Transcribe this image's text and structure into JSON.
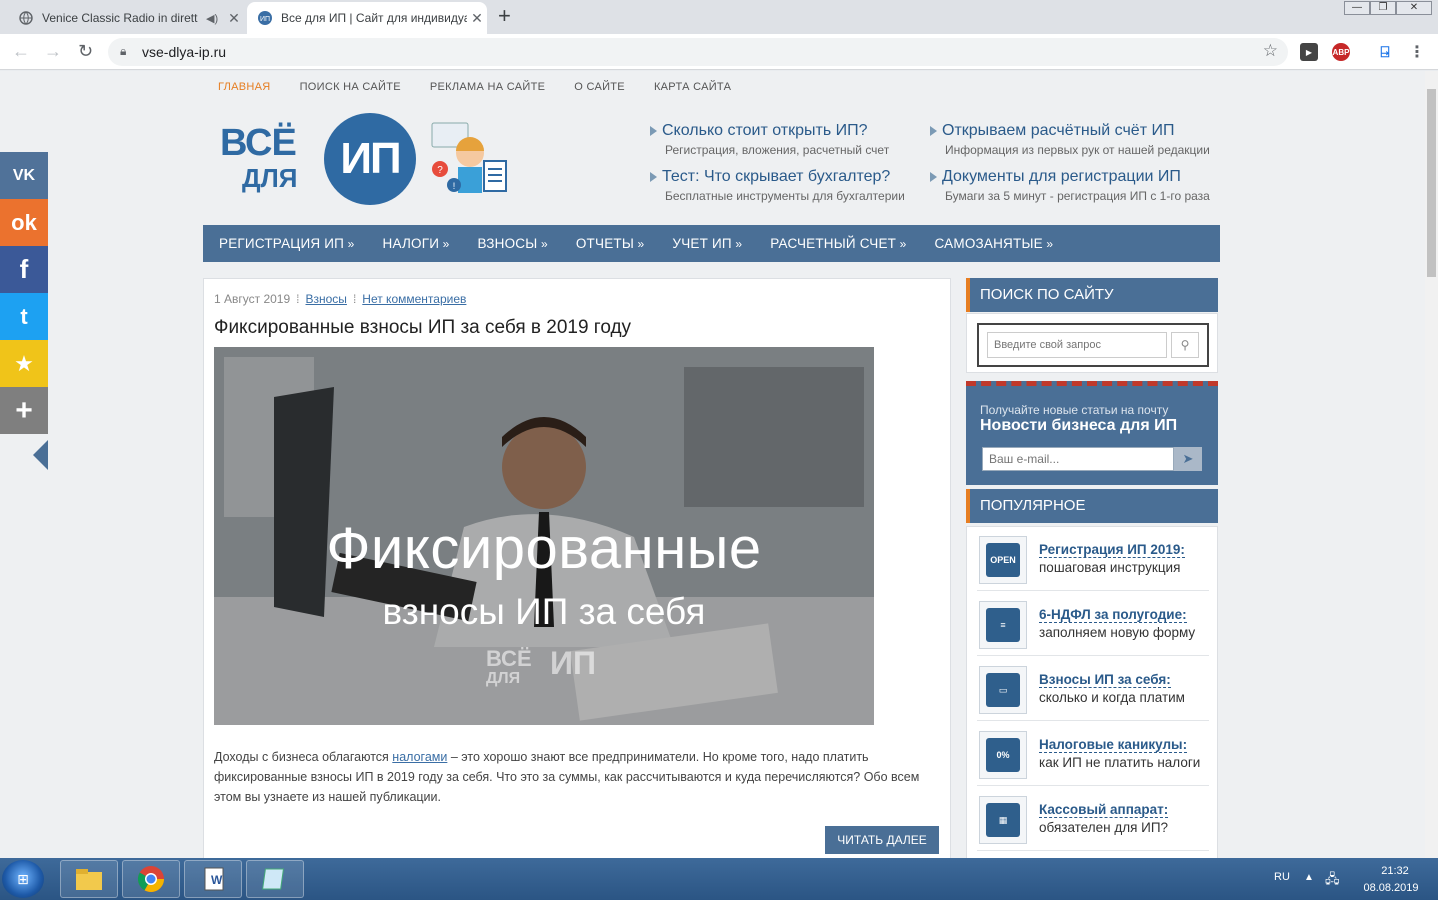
{
  "browser": {
    "tabs": [
      {
        "title": "Venice Classic Radio in dirett",
        "active": false
      },
      {
        "title": "Все для ИП | Сайт для индивидуальных",
        "active": true
      }
    ],
    "url": "vse-dlya-ip.ru",
    "extensions": [
      "video-downloader-icon",
      "adblock-icon",
      "translate-icon"
    ],
    "adblock_label": "ABP"
  },
  "site": {
    "top_menu": [
      "ГЛАВНАЯ",
      "ПОИСК НА САЙТЕ",
      "РЕКЛАМА НА САЙТЕ",
      "О САЙТЕ",
      "КАРТА САЙТА"
    ],
    "logo": {
      "line1": "ВСЁ",
      "line2": "ДЛЯ",
      "ip": "ИП"
    },
    "promos": [
      {
        "title": "Сколько стоит открыть ИП?",
        "subtitle": "Регистрация, вложения, расчетный счет"
      },
      {
        "title": "Открываем расчётный счёт ИП",
        "subtitle": "Информация из первых рук от нашей редакции"
      },
      {
        "title": "Тест: Что скрывает бухгалтер?",
        "subtitle": "Бесплатные инструменты для бухгалтерии"
      },
      {
        "title": "Документы для регистрации ИП",
        "subtitle": "Бумаги за 5 минут - регистрация ИП с 1-го раза"
      }
    ],
    "main_nav": [
      "РЕГИСТРАЦИЯ ИП",
      "НАЛОГИ",
      "ВЗНОСЫ",
      "ОТЧЕТЫ",
      "УЧЕТ ИП",
      "РАСЧЕТНЫЙ СЧЕТ",
      "САМОЗАНЯТЫЕ"
    ]
  },
  "article": {
    "date": "1 Август 2019",
    "separator": "⁞",
    "category": "Взносы",
    "comments": "Нет комментариев",
    "title": "Фиксированные взносы ИП за себя в 2019 году",
    "hero_line1": "Фиксированные",
    "hero_line2": "взносы ИП за себя",
    "hero_wm1": "ВСЁ",
    "hero_wm2": "ДЛЯ",
    "hero_wm3": "ИП",
    "excerpt_before": "Доходы с бизнеса облагаются ",
    "excerpt_link": "налогами",
    "excerpt_after": " – это хорошо знают все предприниматели. Но кроме того, надо платить фиксированные взносы ИП в 2019 году за себя. Что это за суммы, как рассчитываются и куда перечисляются? Обо всем этом вы узнаете из нашей публикации.",
    "read_more": "ЧИТАТЬ ДАЛЕЕ"
  },
  "sidebar": {
    "search_title": "ПОИСК ПО САЙТУ",
    "search_placeholder": "Введите свой запрос",
    "newsletter_text": "Получайте новые статьи на почту",
    "newsletter_title": "Новости бизнеса для ИП",
    "email_placeholder": "Ваш e-mail...",
    "popular_title": "ПОПУЛЯРНОЕ",
    "popular": [
      {
        "title": "Регистрация ИП 2019:",
        "sub": "пошаговая инструкция",
        "icon": "open-sign-icon",
        "icon_text": "OPEN"
      },
      {
        "title": "6-НДФЛ за полугодие:",
        "sub": "заполняем новую форму",
        "icon": "document-icon",
        "icon_text": "≡"
      },
      {
        "title": "Взносы ИП за себя:",
        "sub": "сколько и когда платим",
        "icon": "wallet-icon",
        "icon_text": "▭"
      },
      {
        "title": "Налоговые каникулы:",
        "sub": "как ИП не платить налоги",
        "icon": "calculator-icon",
        "icon_text": "0%"
      },
      {
        "title": "Кассовый аппарат:",
        "sub": "обязателен для ИП?",
        "icon": "cash-register-icon",
        "icon_text": "▦"
      }
    ]
  },
  "social": [
    {
      "name": "vk",
      "glyph": "VK",
      "color": "#507299"
    },
    {
      "name": "odnoklassniki",
      "glyph": "ok",
      "color": "#eb722e"
    },
    {
      "name": "facebook",
      "glyph": "f",
      "color": "#3b5998"
    },
    {
      "name": "twitter",
      "glyph": "t",
      "color": "#1da1f2"
    },
    {
      "name": "bookmark",
      "glyph": "★",
      "color": "#f0c419"
    },
    {
      "name": "more",
      "glyph": "+",
      "color": "#7f7f7f"
    }
  ],
  "taskbar": {
    "lang": "RU",
    "time": "21:32",
    "date": "08.08.2019"
  }
}
